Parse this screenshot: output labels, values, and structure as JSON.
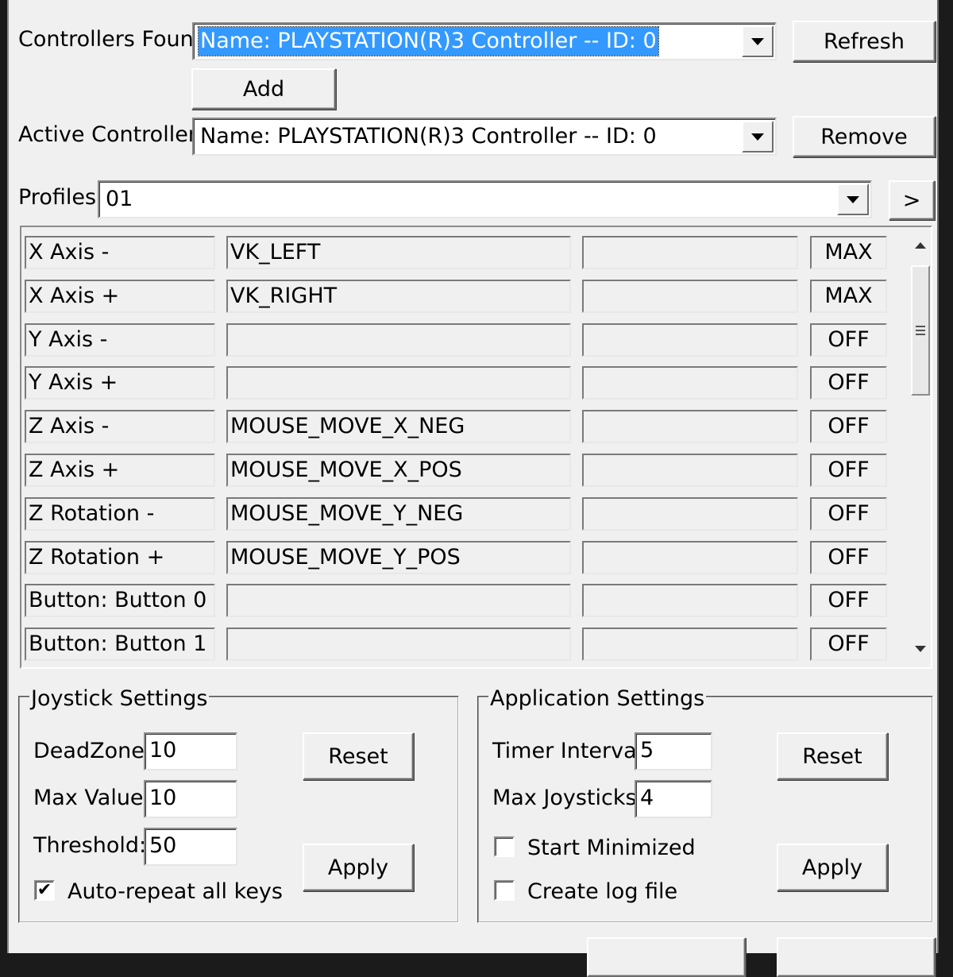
{
  "controllers_found": {
    "label": "Controllers Found:",
    "selected": "Name: PLAYSTATION(R)3 Controller -- ID: 0",
    "refresh_label": "Refresh",
    "add_label": "Add"
  },
  "active_controllers": {
    "label": "Active Controllers:",
    "selected": "Name: PLAYSTATION(R)3 Controller -- ID: 0",
    "remove_label": "Remove"
  },
  "profiles": {
    "label": "Profiles:",
    "selected": "01",
    "next_label": ">"
  },
  "mappings": [
    {
      "input": "X Axis -",
      "key": "VK_LEFT",
      "extra": "",
      "mode": "MAX"
    },
    {
      "input": "X Axis +",
      "key": "VK_RIGHT",
      "extra": "",
      "mode": "MAX"
    },
    {
      "input": "Y Axis -",
      "key": "",
      "extra": "",
      "mode": "OFF"
    },
    {
      "input": "Y Axis +",
      "key": "",
      "extra": "",
      "mode": "OFF"
    },
    {
      "input": "Z Axis -",
      "key": "MOUSE_MOVE_X_NEG",
      "extra": "",
      "mode": "OFF"
    },
    {
      "input": "Z Axis +",
      "key": "MOUSE_MOVE_X_POS",
      "extra": "",
      "mode": "OFF"
    },
    {
      "input": "Z Rotation -",
      "key": "MOUSE_MOVE_Y_NEG",
      "extra": "",
      "mode": "OFF"
    },
    {
      "input": "Z Rotation +",
      "key": "MOUSE_MOVE_Y_POS",
      "extra": "",
      "mode": "OFF"
    },
    {
      "input": "Button: Button 0",
      "key": "",
      "extra": "",
      "mode": "OFF"
    },
    {
      "input": "Button: Button 1",
      "key": "",
      "extra": "",
      "mode": "OFF"
    }
  ],
  "joystick_settings": {
    "title": "Joystick Settings",
    "deadzone_label": "DeadZone:",
    "deadzone_value": "10",
    "max_value_label": "Max Value:",
    "max_value_value": "10",
    "threshold_label": "Threshold:",
    "threshold_value": "50",
    "auto_repeat_label": "Auto-repeat all keys",
    "auto_repeat_checked": true,
    "reset_label": "Reset",
    "apply_label": "Apply"
  },
  "application_settings": {
    "title": "Application Settings",
    "timer_interval_label": "Timer Interval:",
    "timer_interval_value": "5",
    "max_joysticks_label": "Max Joysticks:",
    "max_joysticks_value": "4",
    "start_minimized_label": "Start Minimized",
    "start_minimized_checked": false,
    "create_log_label": "Create log file",
    "create_log_checked": false,
    "reset_label": "Reset",
    "apply_label": "Apply"
  },
  "colors": {
    "selection_highlight": "#3399ff",
    "face": "#f0f0f0"
  }
}
